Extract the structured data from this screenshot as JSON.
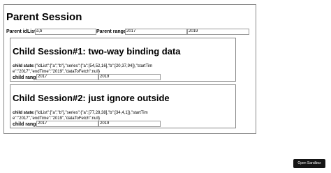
{
  "parent": {
    "title": "Parent Session",
    "idlist_label": "Parent idList:",
    "idlist_value": "a,b",
    "range_label": "Parent range:",
    "range_start": "2017",
    "range_end": "2019"
  },
  "children": [
    {
      "title": "Child Session#1: two-way binding data",
      "state_label": "child state:",
      "state_value": "{\"idList\":[\"a\",\"b\"],\"series\":{\"a\":[54,52,16],\"b\":[20,37,94]},\"startTime\":\"2017\",\"endTime\":\"2019\",\"dataToFetch\":null}",
      "range_label": "child range:",
      "range_start": "2017",
      "range_end": "2019"
    },
    {
      "title": "Child Session#2: just ignore outside",
      "state_label": "child state:",
      "state_value": "{\"idList\":[\"a\",\"b\"],\"series\":{\"a\":[77,28,38],\"b\":[34,4,1]},\"startTime\":\"2017\",\"endTime\":\"2019\",\"dataToFetch\":null}",
      "range_label": "child range:",
      "range_start": "2017",
      "range_end": "2019"
    }
  ],
  "open_sandbox_label": "Open Sandbox"
}
